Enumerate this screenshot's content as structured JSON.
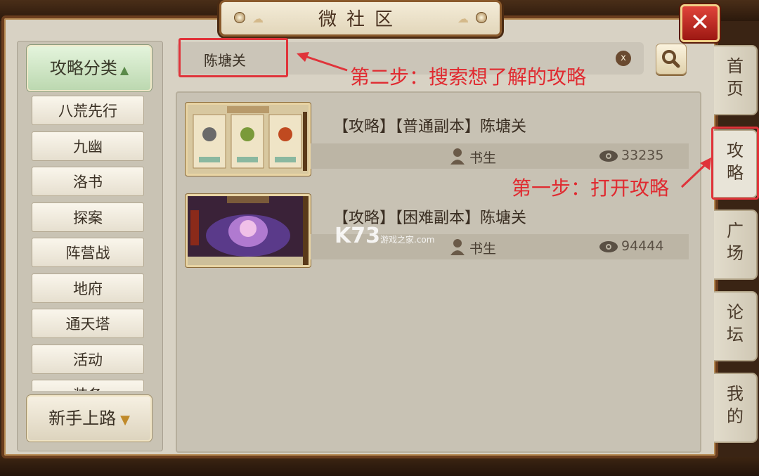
{
  "window": {
    "title": "微社区",
    "close_label": "✕"
  },
  "sidebar": {
    "header": "攻略分类",
    "items": [
      "八荒先行",
      "九幽",
      "洛书",
      "探案",
      "阵营战",
      "地府",
      "通天塔",
      "活动",
      "装备"
    ],
    "footer": "新手上路"
  },
  "search": {
    "value": "陈塘关",
    "clear_label": "x"
  },
  "results": [
    {
      "title": "【攻略】【普通副本】陈塘关",
      "author": "书生",
      "views": "33235"
    },
    {
      "title": "【攻略】【困难副本】陈塘关",
      "author": "书生",
      "views": "94444"
    }
  ],
  "tabs": [
    {
      "label": "首\n页",
      "active": false
    },
    {
      "label": "攻\n略",
      "active": true
    },
    {
      "label": "广\n场",
      "active": false
    },
    {
      "label": "论\n坛",
      "active": false
    },
    {
      "label": "我\n的",
      "active": false
    }
  ],
  "annotations": {
    "step2": "第二步：搜索想了解的攻略",
    "step1": "第一步：打开攻略"
  },
  "watermark": {
    "main": "K73",
    "sub": "游戏之家",
    "domain": ".com"
  },
  "colors": {
    "accent_red": "#e0333a",
    "frame_brown": "#6b3e1e",
    "panel_bg": "#d8d2c4"
  }
}
